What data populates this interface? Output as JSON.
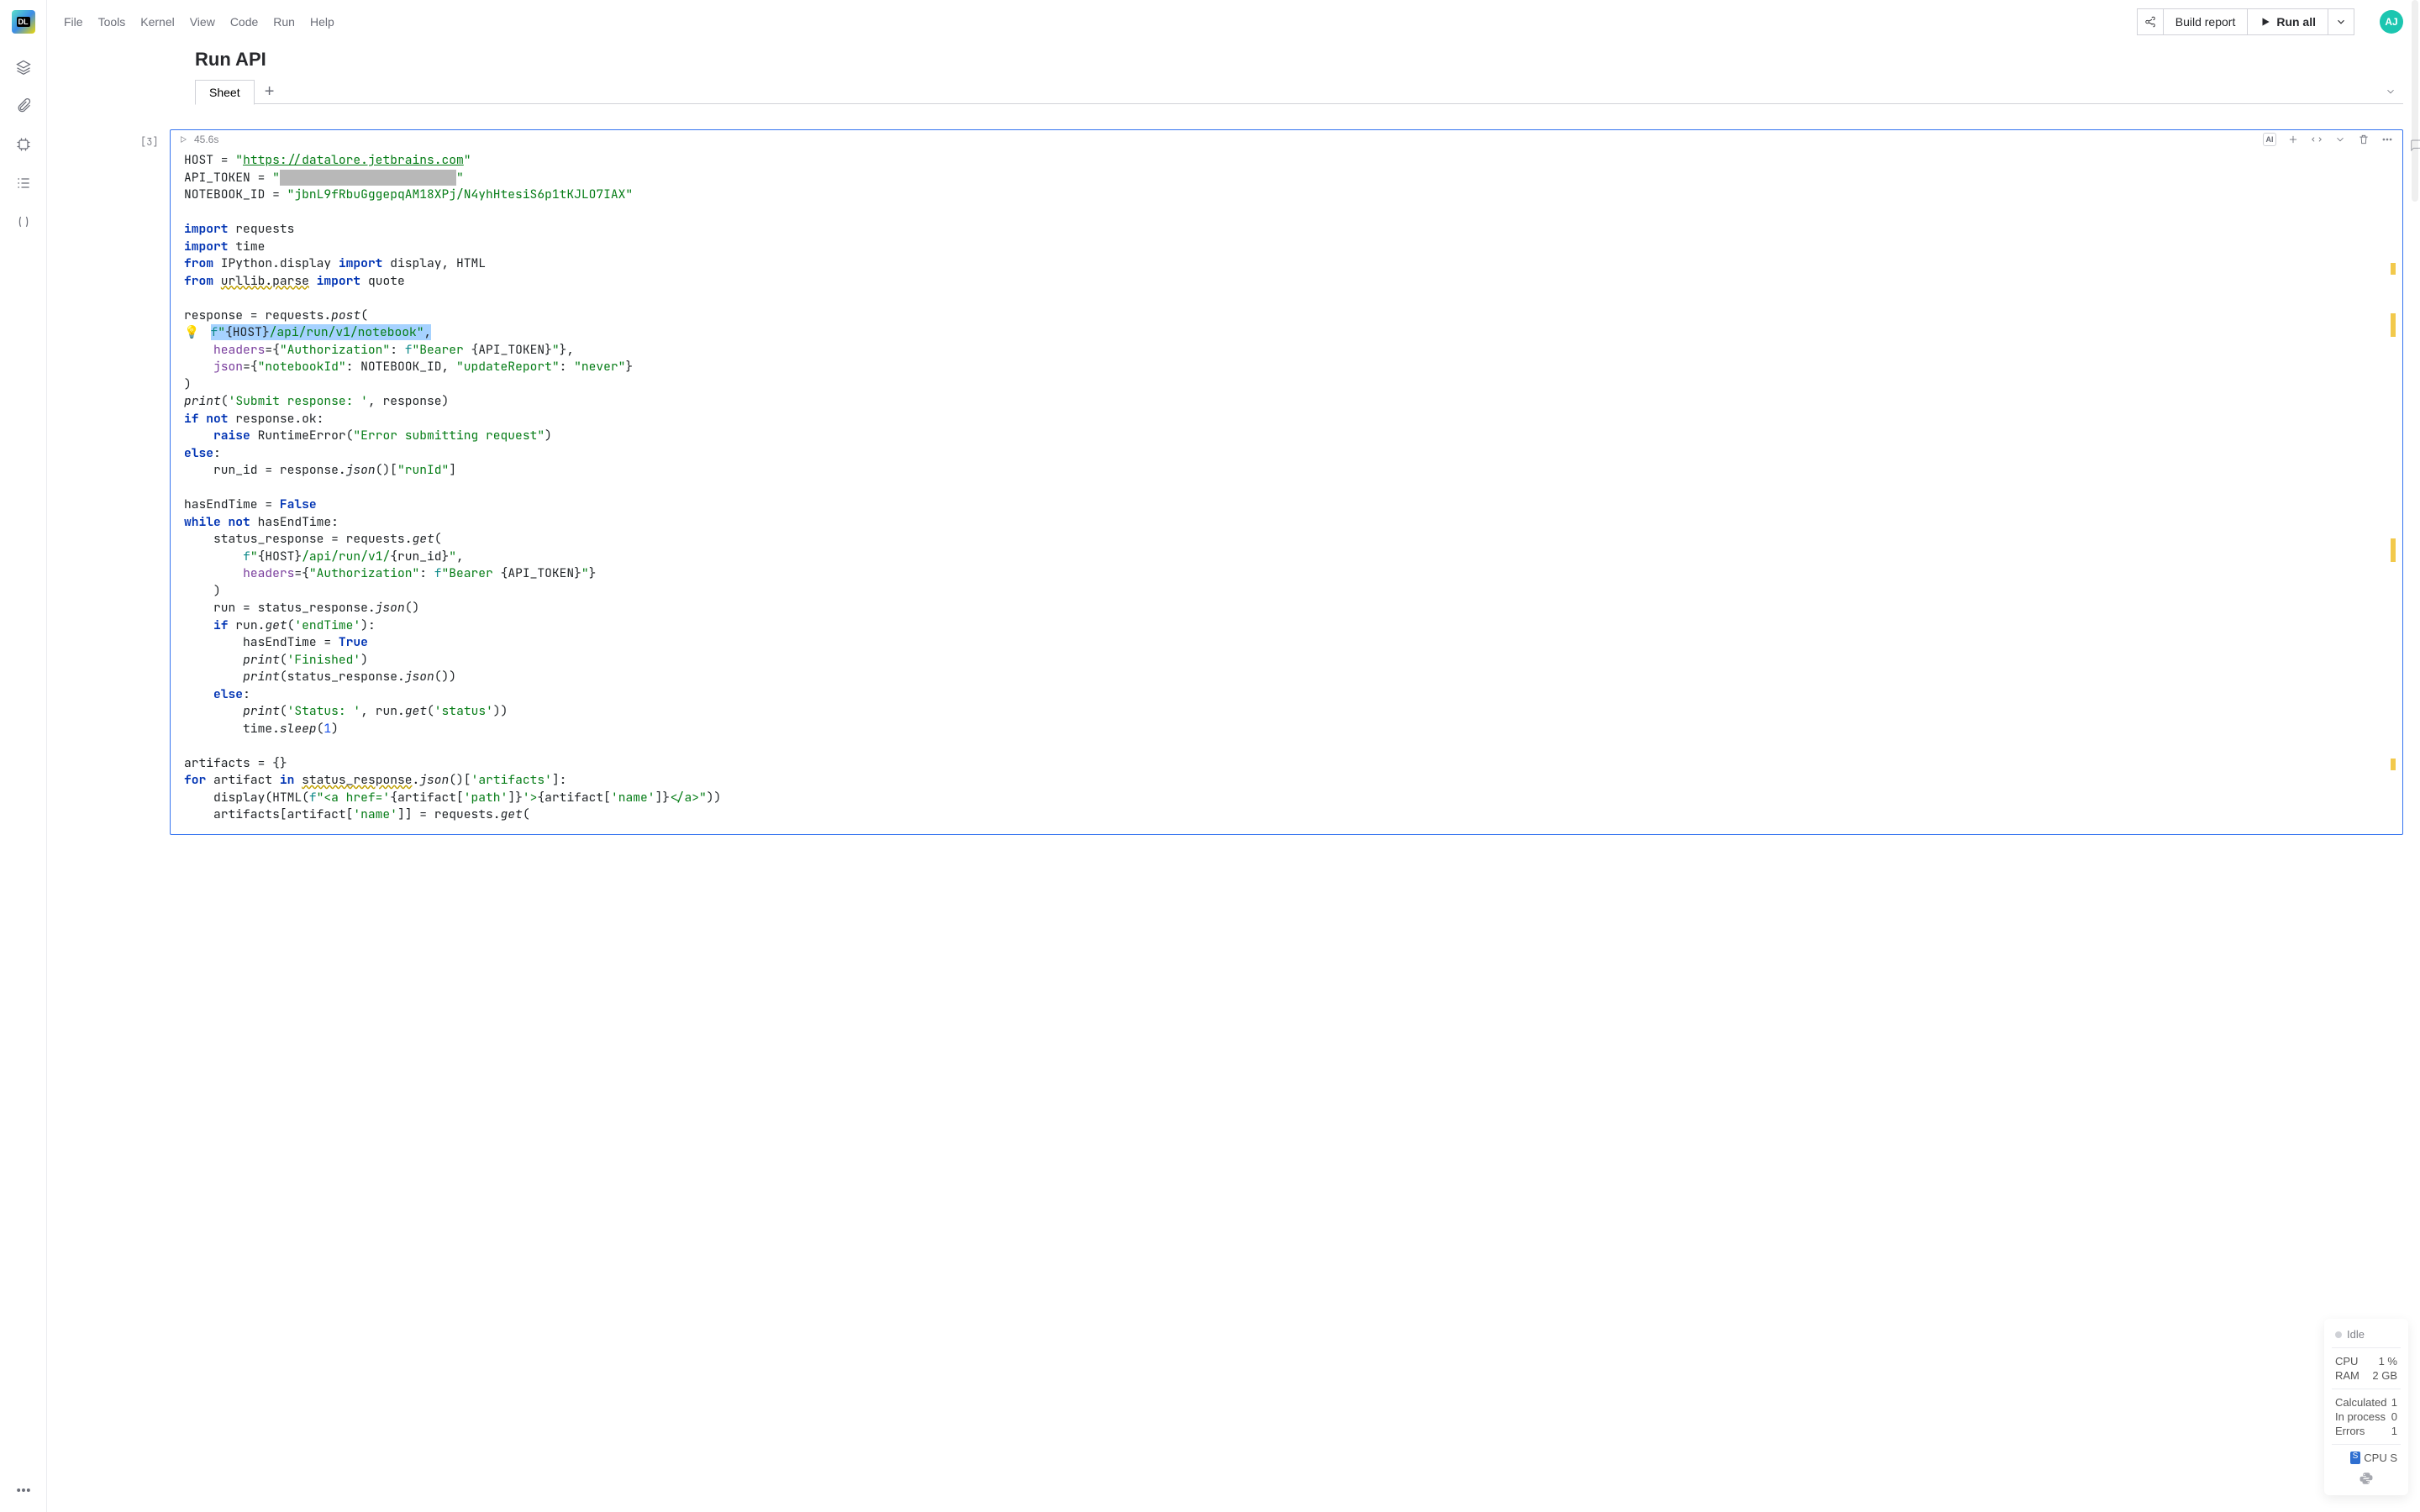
{
  "menu": [
    "File",
    "Tools",
    "Kernel",
    "View",
    "Code",
    "Run",
    "Help"
  ],
  "toolbar": {
    "build_report": "Build report",
    "run_all": "Run all"
  },
  "avatar": "AJ",
  "notebook": {
    "title": "Run API",
    "sheet_tab": "Sheet"
  },
  "cell": {
    "prompt": "[3]",
    "duration": "45.6s"
  },
  "status": {
    "state": "Idle",
    "cpu_label": "CPU",
    "cpu_value": "1 %",
    "ram_label": "RAM",
    "ram_value": "2 GB",
    "calc_label": "Calculated",
    "calc_value": "1",
    "inproc_label": "In process",
    "inproc_value": "0",
    "err_label": "Errors",
    "err_value": "1",
    "machine": "CPU S"
  },
  "code": {
    "host_url": "https://datalore.jetbrains.com",
    "notebook_id": "jbnL9fRbuGggepqAM18XPj/N4yhHtesiS6p1tKJLO7IAX"
  }
}
